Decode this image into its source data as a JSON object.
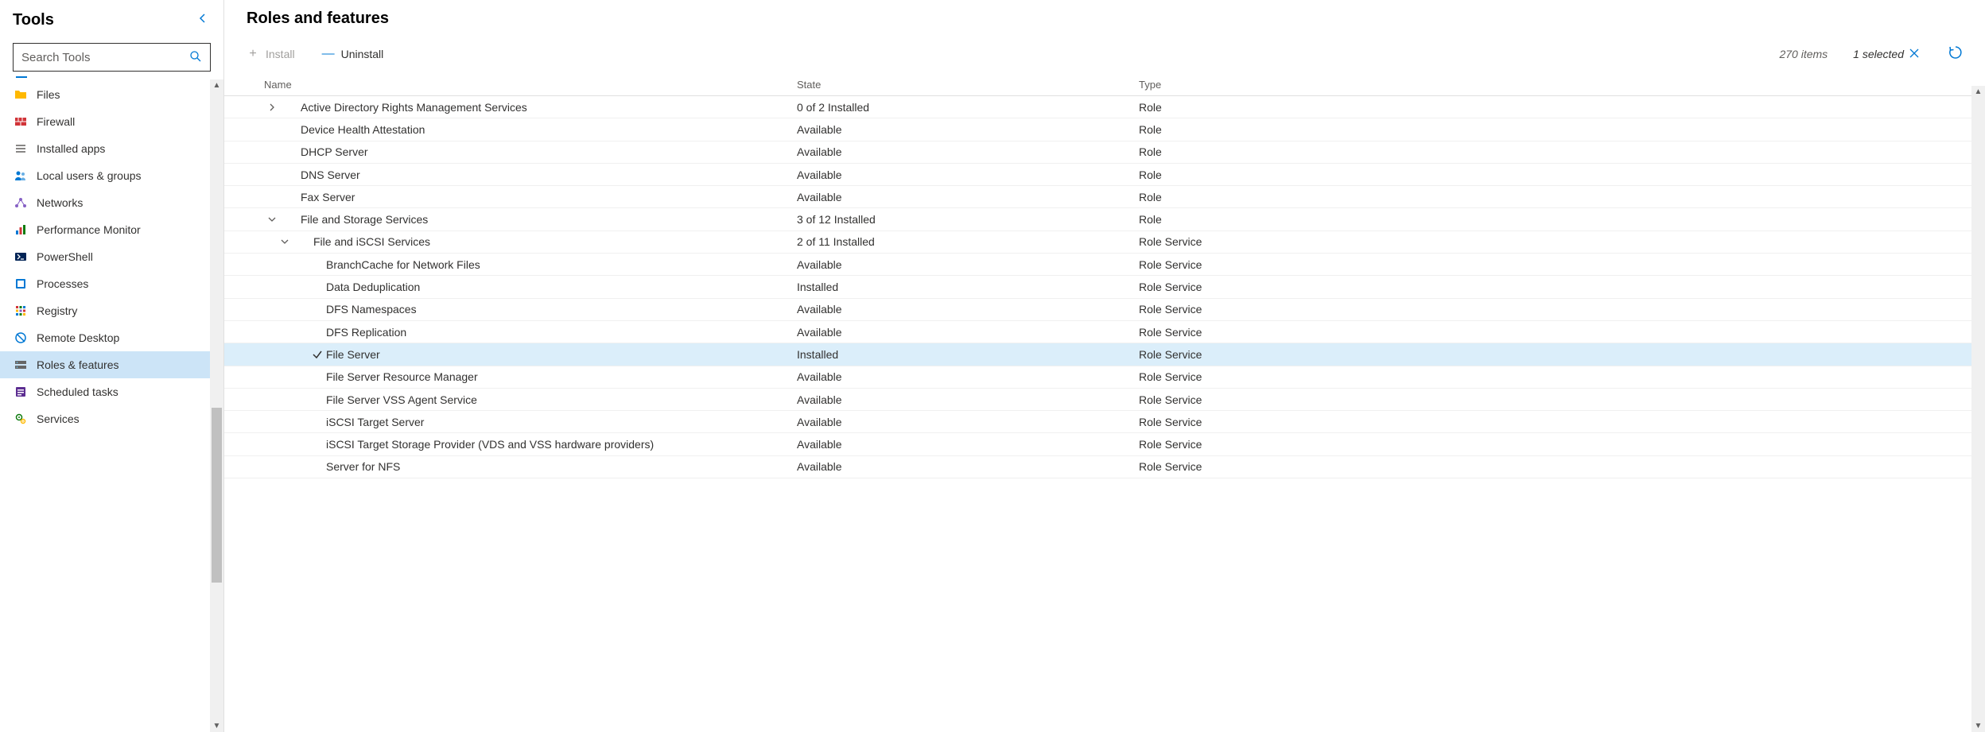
{
  "sidebar": {
    "title": "Tools",
    "search_placeholder": "Search Tools",
    "items": [
      {
        "label": "Files",
        "icon": "folder"
      },
      {
        "label": "Firewall",
        "icon": "firewall"
      },
      {
        "label": "Installed apps",
        "icon": "list"
      },
      {
        "label": "Local users & groups",
        "icon": "users"
      },
      {
        "label": "Networks",
        "icon": "network"
      },
      {
        "label": "Performance Monitor",
        "icon": "perf"
      },
      {
        "label": "PowerShell",
        "icon": "powershell"
      },
      {
        "label": "Processes",
        "icon": "processes"
      },
      {
        "label": "Registry",
        "icon": "registry"
      },
      {
        "label": "Remote Desktop",
        "icon": "rdp"
      },
      {
        "label": "Roles & features",
        "icon": "roles",
        "selected": true
      },
      {
        "label": "Scheduled tasks",
        "icon": "tasks"
      },
      {
        "label": "Services",
        "icon": "services"
      }
    ]
  },
  "main": {
    "title": "Roles and features",
    "toolbar": {
      "install_label": "Install",
      "uninstall_label": "Uninstall",
      "item_count": "270 items",
      "selected_label": "1 selected"
    },
    "columns": {
      "name": "Name",
      "state": "State",
      "type": "Type"
    },
    "rows": [
      {
        "indent": 1,
        "expand": "right",
        "name": "Active Directory Rights Management Services",
        "state": "0 of 2 Installed",
        "type": "Role"
      },
      {
        "indent": 1,
        "expand": "",
        "name": "Device Health Attestation",
        "state": "Available",
        "type": "Role"
      },
      {
        "indent": 1,
        "expand": "",
        "name": "DHCP Server",
        "state": "Available",
        "type": "Role"
      },
      {
        "indent": 1,
        "expand": "",
        "name": "DNS Server",
        "state": "Available",
        "type": "Role"
      },
      {
        "indent": 1,
        "expand": "",
        "name": "Fax Server",
        "state": "Available",
        "type": "Role"
      },
      {
        "indent": 1,
        "expand": "down",
        "name": "File and Storage Services",
        "state": "3 of 12 Installed",
        "type": "Role"
      },
      {
        "indent": 2,
        "expand": "down",
        "name": "File and iSCSI Services",
        "state": "2 of 11 Installed",
        "type": "Role Service"
      },
      {
        "indent": 3,
        "expand": "",
        "name": "BranchCache for Network Files",
        "state": "Available",
        "type": "Role Service"
      },
      {
        "indent": 3,
        "expand": "",
        "name": "Data Deduplication",
        "state": "Installed",
        "type": "Role Service"
      },
      {
        "indent": 3,
        "expand": "",
        "name": "DFS Namespaces",
        "state": "Available",
        "type": "Role Service"
      },
      {
        "indent": 3,
        "expand": "",
        "name": "DFS Replication",
        "state": "Available",
        "type": "Role Service"
      },
      {
        "indent": 3,
        "expand": "",
        "name": "File Server",
        "state": "Installed",
        "type": "Role Service",
        "selected": true,
        "checked": true
      },
      {
        "indent": 3,
        "expand": "",
        "name": "File Server Resource Manager",
        "state": "Available",
        "type": "Role Service"
      },
      {
        "indent": 3,
        "expand": "",
        "name": "File Server VSS Agent Service",
        "state": "Available",
        "type": "Role Service"
      },
      {
        "indent": 3,
        "expand": "",
        "name": "iSCSI Target Server",
        "state": "Available",
        "type": "Role Service"
      },
      {
        "indent": 3,
        "expand": "",
        "name": "iSCSI Target Storage Provider (VDS and VSS hardware providers)",
        "state": "Available",
        "type": "Role Service"
      },
      {
        "indent": 3,
        "expand": "",
        "name": "Server for NFS",
        "state": "Available",
        "type": "Role Service"
      }
    ]
  }
}
